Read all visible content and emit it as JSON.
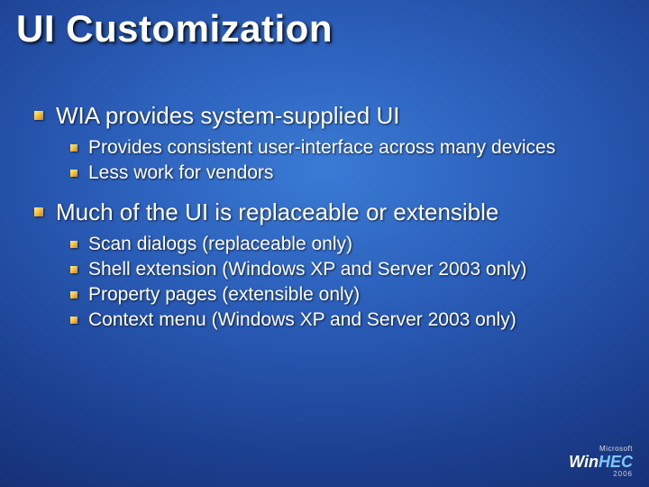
{
  "title": "UI Customization",
  "bullets": [
    {
      "text": "WIA provides system-supplied UI",
      "sub": [
        "Provides consistent user-interface across many devices",
        "Less work for vendors"
      ]
    },
    {
      "text": "Much of the UI is replaceable or extensible",
      "sub": [
        "Scan dialogs (replaceable only)",
        "Shell extension (Windows XP and Server 2003 only)",
        "Property pages (extensible only)",
        "Context menu (Windows XP and Server 2003 only)"
      ]
    }
  ],
  "logo": {
    "top": "Microsoft",
    "main_a": "Win",
    "main_b": "HEC",
    "year": "2006"
  }
}
